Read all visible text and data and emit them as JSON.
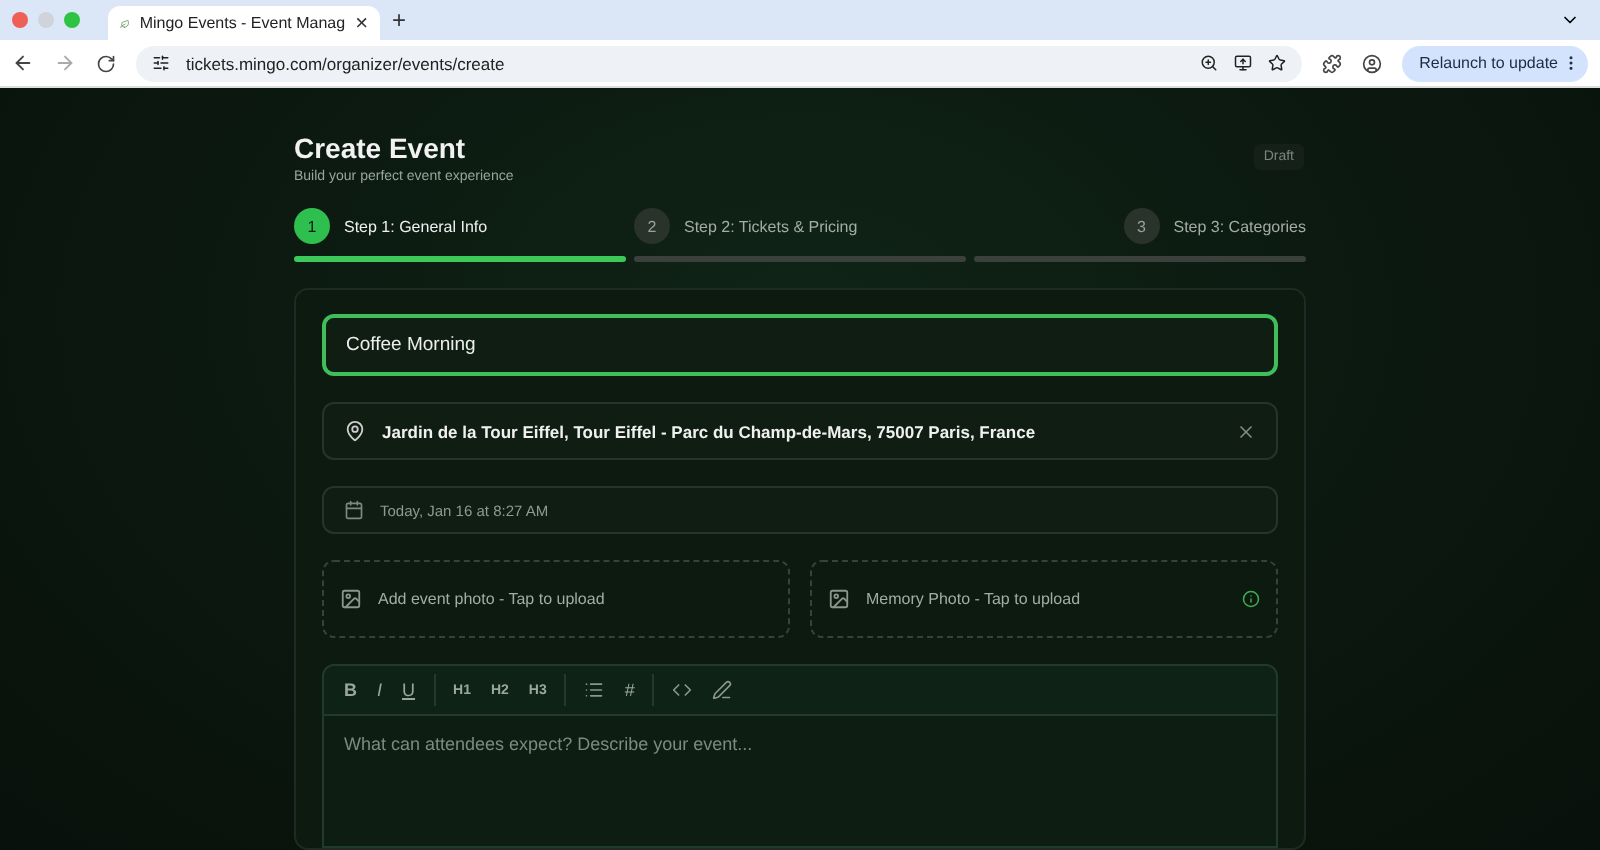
{
  "browser": {
    "tab_title": "Mingo Events - Event Manag",
    "tab_close": "×",
    "new_tab": "+",
    "url": "tickets.mingo.com/organizer/events/create",
    "relaunch": "Relaunch to update"
  },
  "header": {
    "title": "Create Event",
    "subtitle": "Build your perfect event experience",
    "badge": "Draft"
  },
  "steps": [
    {
      "number": "1",
      "label": "Step 1: General Info",
      "selected": true
    },
    {
      "number": "2",
      "label": "Step 2: Tickets & Pricing",
      "selected": false
    },
    {
      "number": "3",
      "label": "Step 3: Categories",
      "selected": false
    }
  ],
  "form": {
    "name_value": "Coffee Morning",
    "location_value": "Jardin de la Tour Eiffel, Tour Eiffel - Parc du Champ-de-Mars, 75007 Paris, France",
    "date_value": "Today, Jan 16 at 8:27 AM",
    "uploads": [
      {
        "label": "Add event photo - Tap to upload",
        "info": false
      },
      {
        "label": "Memory Photo - Tap to upload",
        "info": true
      }
    ],
    "toolbar": [
      {
        "kind": "bold",
        "text": "B"
      },
      {
        "kind": "italic",
        "text": "I"
      },
      {
        "kind": "underline",
        "text": "U"
      },
      {
        "kind": "sep"
      },
      {
        "kind": "heading",
        "text": "H1"
      },
      {
        "kind": "heading",
        "text": "H2"
      },
      {
        "kind": "heading",
        "text": "H3"
      },
      {
        "kind": "sep"
      },
      {
        "kind": "list"
      },
      {
        "kind": "plain",
        "text": "#"
      },
      {
        "kind": "sep"
      },
      {
        "kind": "code"
      },
      {
        "kind": "pen"
      }
    ],
    "description_placeholder": "What can attendees expect? Describe your event..."
  }
}
